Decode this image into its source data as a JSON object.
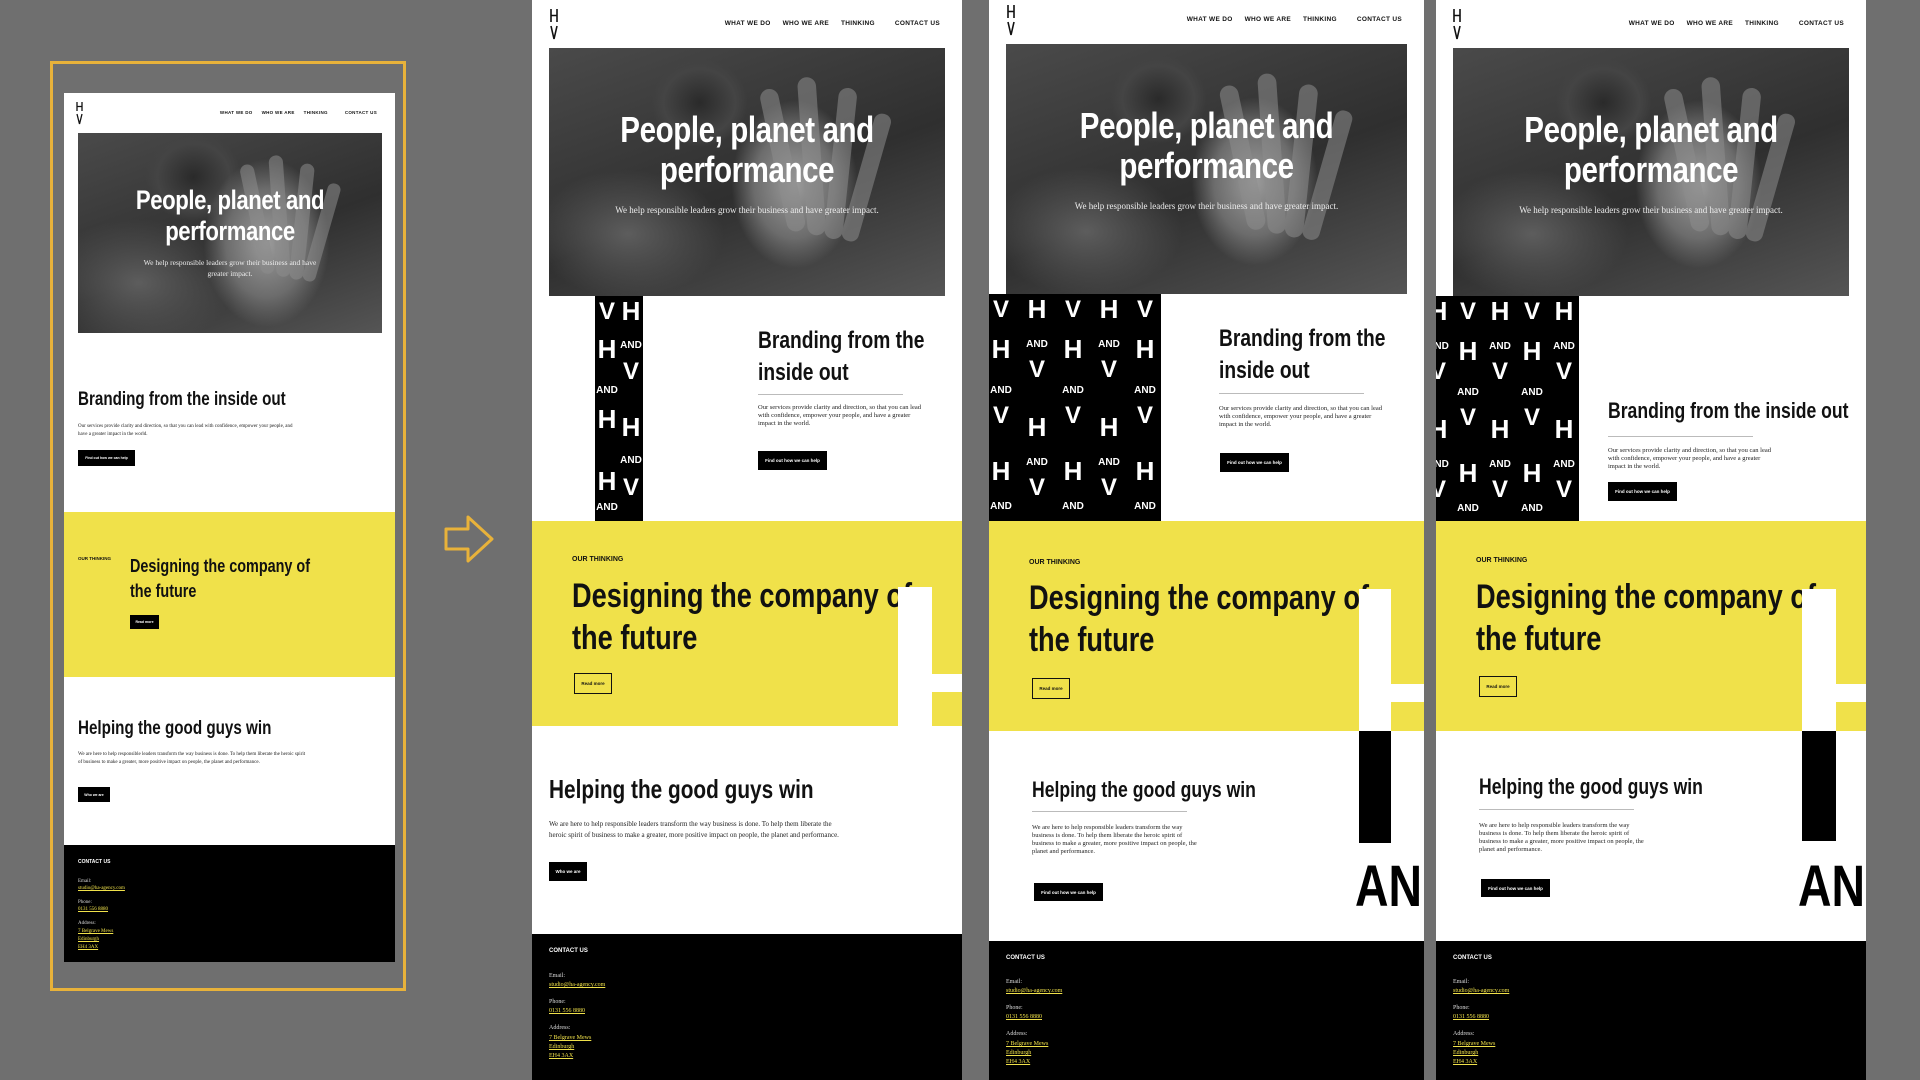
{
  "nav": {
    "what_we_do": "WHAT WE DO",
    "who_we_are": "WHO WE ARE",
    "thinking": "THINKING",
    "contact": "CONTACT US"
  },
  "hero": {
    "title_line1": "People, planet and",
    "title_line2": "performance",
    "subtitle": "We help responsible leaders grow their business and have greater impact."
  },
  "branding": {
    "title": "Branding from the inside out",
    "title_line1": "Branding from the",
    "title_line2": "inside out",
    "body": "Our services provide clarity and direction, so that you can lead with confidence, empower your people, and have a greater impact in the world.",
    "button": "Find out how we can help"
  },
  "thinking": {
    "eyebrow": "OUR THINKING",
    "title": "Designing the company of the future",
    "title_line1": "Designing the company of",
    "title_line2": "the future",
    "button": "Read more"
  },
  "goodguys": {
    "title": "Helping the good guys win",
    "body": "We are here to help responsible leaders transform the way business is done. To help them liberate the heroic spirit of business to make a greater, more positive impact on people, the planet and performance.",
    "button": "Who we are"
  },
  "footer": {
    "heading": "CONTACT US",
    "email_label": "Email:",
    "email": "studio@ha-agency.com",
    "phone_label": "Phone:",
    "phone": "0131 556 8880",
    "address_label": "Address:",
    "address_line1": "7 Belgrave Mews",
    "address_line2": "Edinburgh",
    "address_line3": "EH4 3AX"
  },
  "pattern": {
    "h": "H",
    "v": "V",
    "and": "AND",
    "an": "AN"
  },
  "colors": {
    "accent": "#f0e14a",
    "background": "#6f6f6f",
    "highlight_frame": "#e8b23a"
  },
  "icons": {
    "arrow": "arrow-right-icon",
    "logo": "ha-logo-icon"
  }
}
